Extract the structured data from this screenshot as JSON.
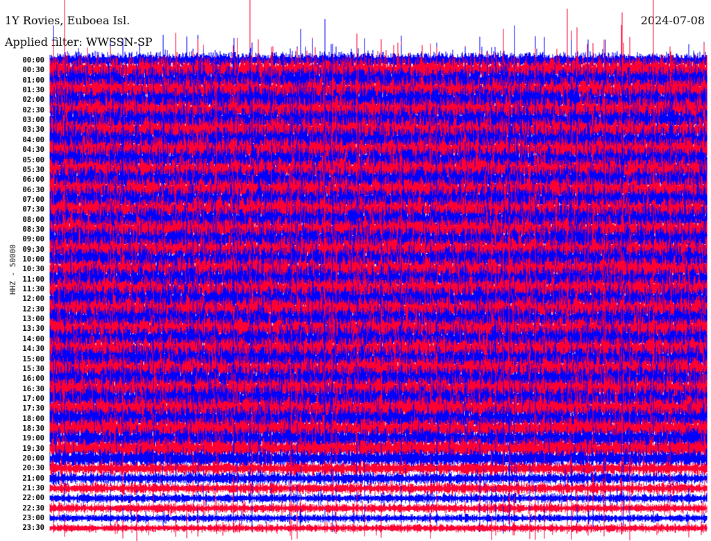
{
  "header": {
    "station": "1Y Rovies, Euboea Isl.",
    "filter": "Applied filter: WWSSN-SP",
    "date": "2024-07-08"
  },
  "chart_data": {
    "type": "line",
    "title": "1Y Rovies, Euboea Isl.",
    "ylabel": "HHZ - 50000",
    "colors": [
      "#0000ff",
      "#ff0033"
    ],
    "tick_labels": [
      "00:00",
      "00:30",
      "01:00",
      "01:30",
      "02:00",
      "02:30",
      "03:00",
      "03:30",
      "04:00",
      "04:30",
      "05:00",
      "05:30",
      "06:00",
      "06:30",
      "07:00",
      "07:30",
      "08:00",
      "08:30",
      "09:00",
      "09:30",
      "10:00",
      "10:30",
      "11:00",
      "11:30",
      "12:00",
      "12:30",
      "13:00",
      "13:30",
      "14:00",
      "14:30",
      "15:00",
      "15:30",
      "16:00",
      "16:30",
      "17:00",
      "17:30",
      "18:00",
      "18:30",
      "19:00",
      "19:30",
      "20:00",
      "20:30",
      "21:00",
      "21:30",
      "22:00",
      "22:30",
      "23:00",
      "23:30"
    ],
    "relative_amplitude": [
      0.6,
      1,
      1,
      1,
      1,
      1,
      1,
      1,
      1,
      1,
      1,
      1,
      1,
      1,
      1,
      1,
      1,
      1,
      1,
      1,
      1,
      1,
      1,
      1,
      1,
      1,
      1,
      1,
      1,
      1,
      1,
      1,
      1,
      1,
      1,
      1,
      0.9,
      0.9,
      0.8,
      0.8,
      0.7,
      0.5,
      0.45,
      0.4,
      0.35,
      0.35,
      0.3,
      0.3
    ]
  }
}
